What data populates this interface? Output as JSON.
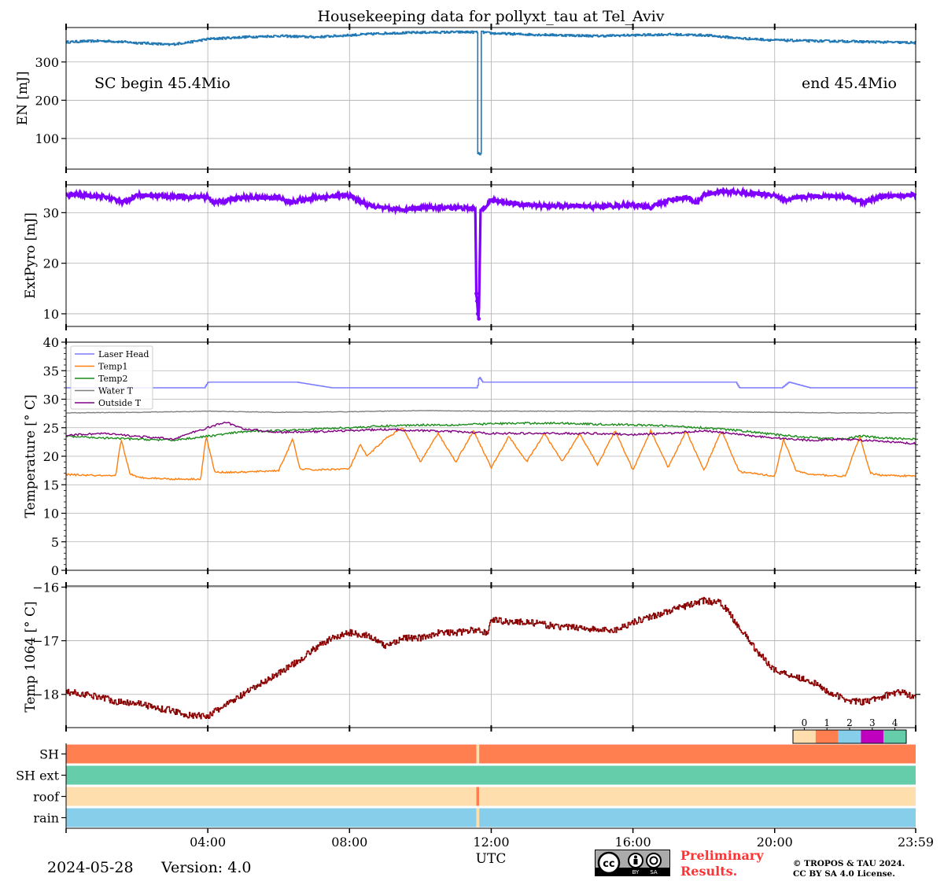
{
  "title": "Housekeeping data for pollyxt_tau at Tel_Aviv",
  "footer": {
    "date": "2024-05-28",
    "version": "Version: 4.0",
    "preliminary_line1": "Preliminary",
    "preliminary_line2": "Results.",
    "copyright_line1": "© TROPOS & TAU 2024.",
    "copyright_line2": "CC BY SA 4.0 License.",
    "license_badge_text": "cc BY SA"
  },
  "chart_data": [
    {
      "type": "line",
      "panel": "energy",
      "ylabel": "EN [mJ]",
      "yticks": [
        100,
        200,
        300
      ],
      "ylim": [
        20,
        390
      ],
      "color": "#1f77b4",
      "annotations": [
        "SC begin 45.4Mio",
        "end 45.4Mio"
      ],
      "series": [
        {
          "x": [
            0,
            0.5,
            1,
            1.5,
            2,
            2.5,
            2.9,
            3.5,
            4,
            5,
            6,
            7,
            8,
            9,
            10,
            11,
            11.6,
            11.62,
            11.7,
            11.72,
            12,
            13,
            14,
            15,
            16,
            17,
            18,
            19,
            20,
            21,
            22,
            23,
            23.98
          ],
          "y": [
            352,
            354,
            355,
            353,
            350,
            348,
            345,
            352,
            360,
            365,
            368,
            365,
            370,
            375,
            377,
            378,
            378,
            60,
            60,
            378,
            375,
            372,
            370,
            368,
            370,
            372,
            370,
            362,
            357,
            355,
            354,
            352,
            350
          ]
        }
      ]
    },
    {
      "type": "line",
      "panel": "extpyro",
      "ylabel": "ExtPyro [mJ]",
      "yticks": [
        10,
        20,
        30
      ],
      "ylim": [
        7.5,
        35.5
      ],
      "color": "#7f00ff",
      "series": [
        {
          "x": [
            0,
            0.5,
            1,
            1.5,
            1.6,
            2,
            3,
            4,
            4.2,
            5,
            6,
            6.3,
            7,
            8,
            8.5,
            9,
            9.5,
            10,
            11,
            11.55,
            11.58,
            11.6,
            11.62,
            11.65,
            11.7,
            11.8,
            12,
            13,
            14,
            15,
            16,
            16.5,
            17,
            17.5,
            17.8,
            18,
            18.5,
            19,
            20,
            20.3,
            21,
            22,
            22.5,
            23,
            23.98
          ],
          "y": [
            33.5,
            33.5,
            33.2,
            32.5,
            32,
            33.5,
            33.2,
            33,
            32,
            33,
            33,
            32,
            33,
            33.4,
            31.5,
            30.8,
            30.6,
            31,
            31,
            30.8,
            14,
            12.5,
            10,
            9,
            30.5,
            31,
            32.5,
            31.5,
            31.3,
            31.2,
            31.5,
            31,
            32.5,
            33,
            32,
            33.5,
            34.2,
            34,
            33.5,
            32.5,
            33.3,
            33.2,
            32,
            33.2,
            33.5
          ]
        }
      ]
    },
    {
      "type": "line",
      "panel": "temperature",
      "ylabel": "Temperature [$^\\circ C$]",
      "yticks": [
        0,
        5,
        10,
        15,
        20,
        25,
        30,
        35,
        40
      ],
      "ylim": [
        0,
        40
      ],
      "legend": [
        "Laser Head",
        "Temp1",
        "Temp2",
        "Water T",
        "Outside T"
      ],
      "legend_position": "upper-left",
      "series": [
        {
          "name": "Laser Head",
          "color": "#7b7bff",
          "x": [
            0,
            3.9,
            4,
            6.5,
            7.5,
            8,
            11.6,
            11.65,
            11.75,
            12,
            18.9,
            19,
            20.2,
            20.4,
            21,
            21.5,
            23,
            23.98
          ],
          "y": [
            32,
            32,
            33,
            33,
            32,
            32,
            32,
            34,
            33,
            33,
            33,
            32,
            32,
            33,
            32,
            32,
            32,
            32
          ]
        },
        {
          "name": "Temp1",
          "color": "#ff7f0e",
          "x": [
            0,
            1.4,
            1.55,
            1.8,
            2,
            3,
            3.8,
            3.95,
            4.2,
            5,
            6,
            6.4,
            6.6,
            7,
            8,
            8.3,
            8.5,
            9,
            9.5,
            10,
            10.5,
            11,
            11.5,
            12,
            12.5,
            13,
            13.5,
            14,
            14.5,
            15,
            15.5,
            16,
            16.5,
            17,
            17.5,
            18,
            18.5,
            19,
            20,
            20.25,
            20.6,
            21,
            22,
            22.4,
            22.7,
            23,
            23.98
          ],
          "y": [
            16.8,
            16.5,
            23,
            17,
            16.3,
            16,
            16,
            23.5,
            17.2,
            17.2,
            17.5,
            23,
            17.8,
            17.6,
            17.8,
            22,
            20,
            23,
            25,
            19,
            24,
            19,
            24.5,
            18,
            23.5,
            19,
            24,
            19,
            24,
            18.5,
            24.5,
            17.5,
            24.5,
            18,
            24.5,
            17.5,
            24.5,
            17.3,
            16.5,
            23,
            17.5,
            16.8,
            16.5,
            23.5,
            17,
            16.7,
            16.5
          ]
        },
        {
          "name": "Temp2",
          "color": "#1a8c1a",
          "x": [
            0,
            1,
            2,
            3,
            4,
            5,
            6,
            7,
            8,
            9,
            10,
            11,
            12,
            13,
            14,
            15,
            16,
            17,
            18,
            19,
            20,
            21,
            22,
            22.4,
            23,
            23.98
          ],
          "y": [
            23.5,
            23.2,
            23,
            22.8,
            23.5,
            24.3,
            24.5,
            24.8,
            25,
            25.3,
            25.5,
            25.5,
            25.7,
            25.8,
            25.8,
            25.6,
            25.5,
            25.3,
            25,
            24.5,
            23.8,
            23.3,
            23,
            23.6,
            23.2,
            23
          ]
        },
        {
          "name": "Water T",
          "color": "#7f7f7f",
          "x": [
            0,
            2,
            4,
            6,
            8,
            10,
            12,
            14,
            16,
            18,
            20,
            22,
            23.98
          ],
          "y": [
            27.6,
            27.7,
            27.9,
            27.7,
            27.8,
            28,
            27.9,
            27.9,
            27.9,
            27.8,
            27.7,
            27.6,
            27.6
          ]
        },
        {
          "name": "Outside T",
          "color": "#800080",
          "x": [
            0,
            1,
            2,
            3,
            4,
            4.5,
            5,
            6,
            7,
            8,
            9,
            10,
            11,
            12,
            13,
            14,
            15,
            16,
            17,
            18,
            19,
            20,
            21,
            22,
            23,
            23.98
          ],
          "y": [
            23.7,
            24,
            23.5,
            23,
            25,
            26,
            24.8,
            24.2,
            24.3,
            24.5,
            24.7,
            24.5,
            24.3,
            24,
            24,
            24,
            24,
            23.8,
            24,
            24.5,
            23.8,
            23.2,
            22.8,
            23,
            22.6,
            22.2
          ]
        }
      ]
    },
    {
      "type": "line",
      "panel": "temp1064",
      "ylabel": "Temp 1064 [$^\\circ C$]",
      "yticks": [
        -18,
        -17,
        -16
      ],
      "ylim": [
        -18.62,
        -15.98
      ],
      "color": "#8b0000",
      "series": [
        {
          "x": [
            0,
            0.5,
            1,
            1.5,
            2,
            2.5,
            3,
            3.5,
            4,
            4.5,
            5,
            5.5,
            6,
            6.5,
            7,
            7.5,
            8,
            8.5,
            9,
            9.5,
            10,
            10.5,
            11,
            11.5,
            11.9,
            12,
            12.5,
            13,
            13.5,
            14,
            14.5,
            15,
            15.5,
            16,
            16.5,
            17,
            17.5,
            18,
            18.5,
            19,
            19.5,
            20,
            20.5,
            21,
            21.5,
            22,
            22.5,
            23,
            23.5,
            23.98
          ],
          "y": [
            -17.95,
            -18,
            -18.05,
            -18.15,
            -18.15,
            -18.25,
            -18.3,
            -18.4,
            -18.4,
            -18.2,
            -18,
            -17.8,
            -17.6,
            -17.4,
            -17.15,
            -16.95,
            -16.85,
            -16.9,
            -17.1,
            -16.95,
            -16.95,
            -16.85,
            -16.85,
            -16.8,
            -16.85,
            -16.6,
            -16.65,
            -16.65,
            -16.7,
            -16.75,
            -16.75,
            -16.8,
            -16.8,
            -16.65,
            -16.55,
            -16.45,
            -16.35,
            -16.25,
            -16.3,
            -16.75,
            -17.2,
            -17.55,
            -17.65,
            -17.75,
            -17.95,
            -18.1,
            -18.15,
            -18.05,
            -17.95,
            -18.05
          ]
        }
      ]
    },
    {
      "type": "heatmap",
      "panel": "status",
      "rows": [
        "SH",
        "SH ext",
        "roof",
        "rain"
      ],
      "colorbar_labels": [
        "0",
        "1",
        "2",
        "3",
        "4"
      ],
      "colorbar_colors": [
        "#ffdead",
        "#ff7f50",
        "#87ceeb",
        "#bf00bf",
        "#66cdaa"
      ],
      "segments": [
        [
          {
            "from": 0,
            "to": 11.58,
            "state": 1
          },
          {
            "from": 11.58,
            "to": 11.66,
            "state": 0
          },
          {
            "from": 11.66,
            "to": 23.98,
            "state": 1
          }
        ],
        [
          {
            "from": 0,
            "to": 23.98,
            "state": 4
          }
        ],
        [
          {
            "from": 0,
            "to": 11.58,
            "state": 0
          },
          {
            "from": 11.58,
            "to": 11.66,
            "state": 1
          },
          {
            "from": 11.66,
            "to": 23.98,
            "state": 0
          }
        ],
        [
          {
            "from": 0,
            "to": 11.58,
            "state": 2
          },
          {
            "from": 11.58,
            "to": 11.66,
            "state": 0
          },
          {
            "from": 11.66,
            "to": 23.98,
            "state": 2
          }
        ]
      ],
      "xlabel": "UTC",
      "xticks": [
        "04:00",
        "08:00",
        "12:00",
        "16:00",
        "20:00",
        "23:59"
      ],
      "xlim": [
        0,
        23.98
      ]
    }
  ]
}
